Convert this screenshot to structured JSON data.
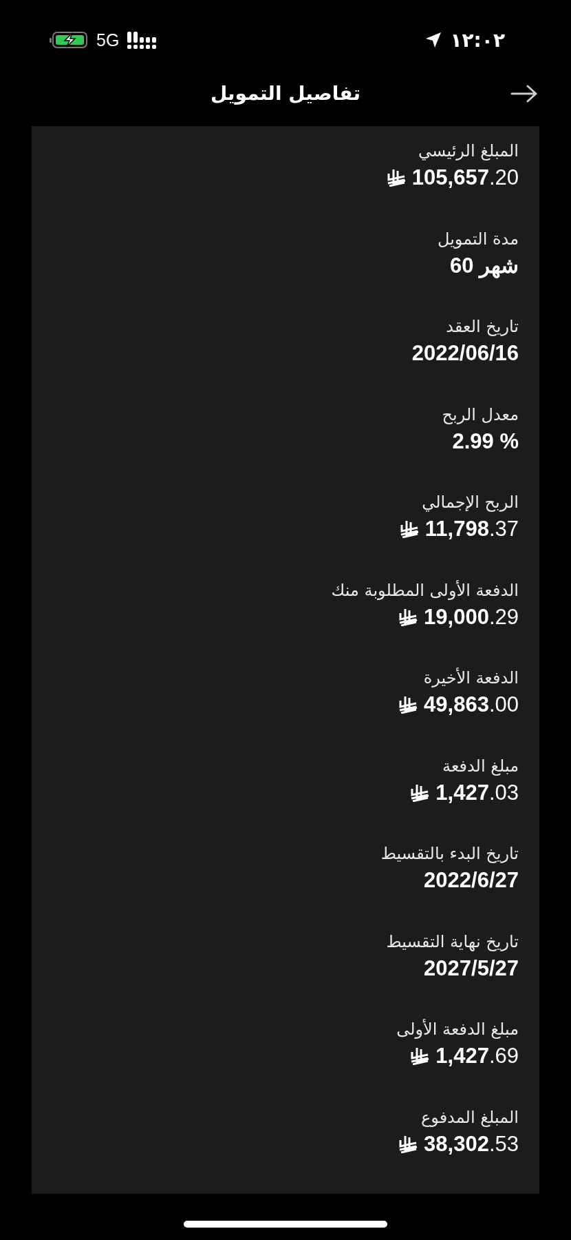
{
  "status_bar": {
    "time": "١٢:٠٢",
    "network": "5G",
    "charging": true
  },
  "header": {
    "title": "تفاصيل التمويل"
  },
  "details": [
    {
      "label": "المبلغ الرئيسي",
      "value": "**105,657**.20",
      "kind": "amount"
    },
    {
      "label": "مدة التمويل",
      "value": "60 شهر",
      "kind": "text"
    },
    {
      "label": "تاريخ العقد",
      "value": "2022/06/16",
      "kind": "text"
    },
    {
      "label": "معدل الربح",
      "value": "2.99 %",
      "kind": "text"
    },
    {
      "label": "الربح الإجمالي",
      "value": "**11,798**.37",
      "kind": "amount"
    },
    {
      "label": "الدفعة الأولى المطلوبة منك",
      "value": "**19,000**.29",
      "kind": "amount"
    },
    {
      "label": "الدفعة الأخيرة",
      "value": "**49,863**.00",
      "kind": "amount"
    },
    {
      "label": "مبلغ الدفعة",
      "value": "**1,427**.03",
      "kind": "amount"
    },
    {
      "label": "تاريخ البدء بالتقسيط",
      "value": "2022/6/27",
      "kind": "text"
    },
    {
      "label": "تاريخ نهاية التقسيط",
      "value": "2027/5/27",
      "kind": "text"
    },
    {
      "label": "مبلغ الدفعة الأولى",
      "value": "**1,427**.69",
      "kind": "amount"
    },
    {
      "label": "المبلغ المدفوع",
      "value": "**38,302**.53",
      "kind": "amount"
    }
  ]
}
